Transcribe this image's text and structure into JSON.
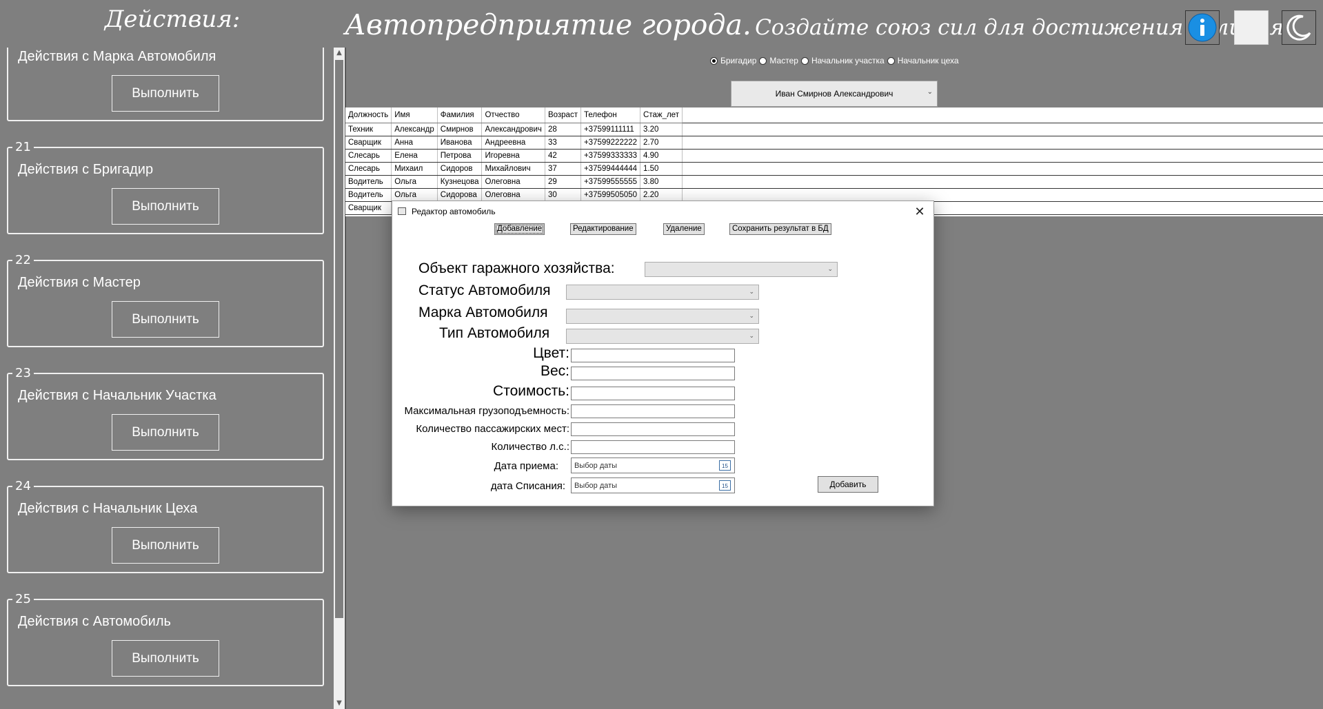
{
  "left_panel": {
    "title": "Действия:",
    "groups": [
      {
        "number": "",
        "title": "Действия с Марка Автомобиля",
        "button": "Выполнить"
      },
      {
        "number": "21",
        "title": "Действия с Бригадир",
        "button": "Выполнить"
      },
      {
        "number": "22",
        "title": "Действия с Мастер",
        "button": "Выполнить"
      },
      {
        "number": "23",
        "title": "Действия с Начальник Участка",
        "button": "Выполнить"
      },
      {
        "number": "24",
        "title": "Действия с Начальник Цеха",
        "button": "Выполнить"
      },
      {
        "number": "25",
        "title": "Действия с Автомобиль",
        "button": "Выполнить"
      }
    ]
  },
  "header": {
    "title_main": "Автопредприятие города.",
    "title_slogan": "Создайте союз сил для достижения величия!",
    "info_icon": "info-icon",
    "theme_icon": "moon-icon"
  },
  "roles": {
    "options": [
      "Бригадир",
      "Мастер",
      "Начальник участка",
      "Начальник цеха"
    ],
    "selected": "Бригадир"
  },
  "person_select": {
    "value": "Иван Смирнов Александрович"
  },
  "grid": {
    "columns": [
      "Должность",
      "Имя",
      "Фамилия",
      "Отчество",
      "Возраст",
      "Телефон",
      "Стаж_лет"
    ],
    "rows": [
      [
        "Техник",
        "Александр",
        "Смирнов",
        "Александрович",
        "28",
        "+37599111111",
        "3.20"
      ],
      [
        "Сварщик",
        "Анна",
        "Иванова",
        "Андреевна",
        "33",
        "+37599222222",
        "2.70"
      ],
      [
        "Слесарь",
        "Елена",
        "Петрова",
        "Игоревна",
        "42",
        "+37599333333",
        "4.90"
      ],
      [
        "Слесарь",
        "Михаил",
        "Сидоров",
        "Михайлович",
        "37",
        "+37599444444",
        "1.50"
      ],
      [
        "Водитель",
        "Ольга",
        "Кузнецова",
        "Олеговна",
        "29",
        "+37599555555",
        "3.80"
      ],
      [
        "Водитель",
        "Ольга",
        "Сидорова",
        "Олеговна",
        "30",
        "+37599505050",
        "2.20"
      ],
      [
        "Сварщик",
        "",
        "",
        "",
        "",
        "",
        ""
      ]
    ]
  },
  "dialog": {
    "title": "Редактор автомобиль",
    "tabs": [
      "Добавление",
      "Редактирование",
      "Удаление",
      "Сохранить результат в БД"
    ],
    "labels": {
      "garage_object": "Объект гаражного хозяйства:",
      "car_status": "Статус Автомобиля",
      "car_brand": "Марка Автомобиля",
      "car_type": "Тип Автомобиля",
      "color": "Цвет:",
      "weight": "Вес:",
      "cost": "Стоимость:",
      "max_payload": "Максимальная грузоподъемность:",
      "seats": "Количество пассажирских мест:",
      "horsepower": "Количество л.с.:",
      "date_accept": "Дата приема:",
      "date_writeoff": "дата Списания:"
    },
    "date_placeholder": "Выбор даты",
    "calendar_day": "15",
    "add_button": "Добавить"
  }
}
